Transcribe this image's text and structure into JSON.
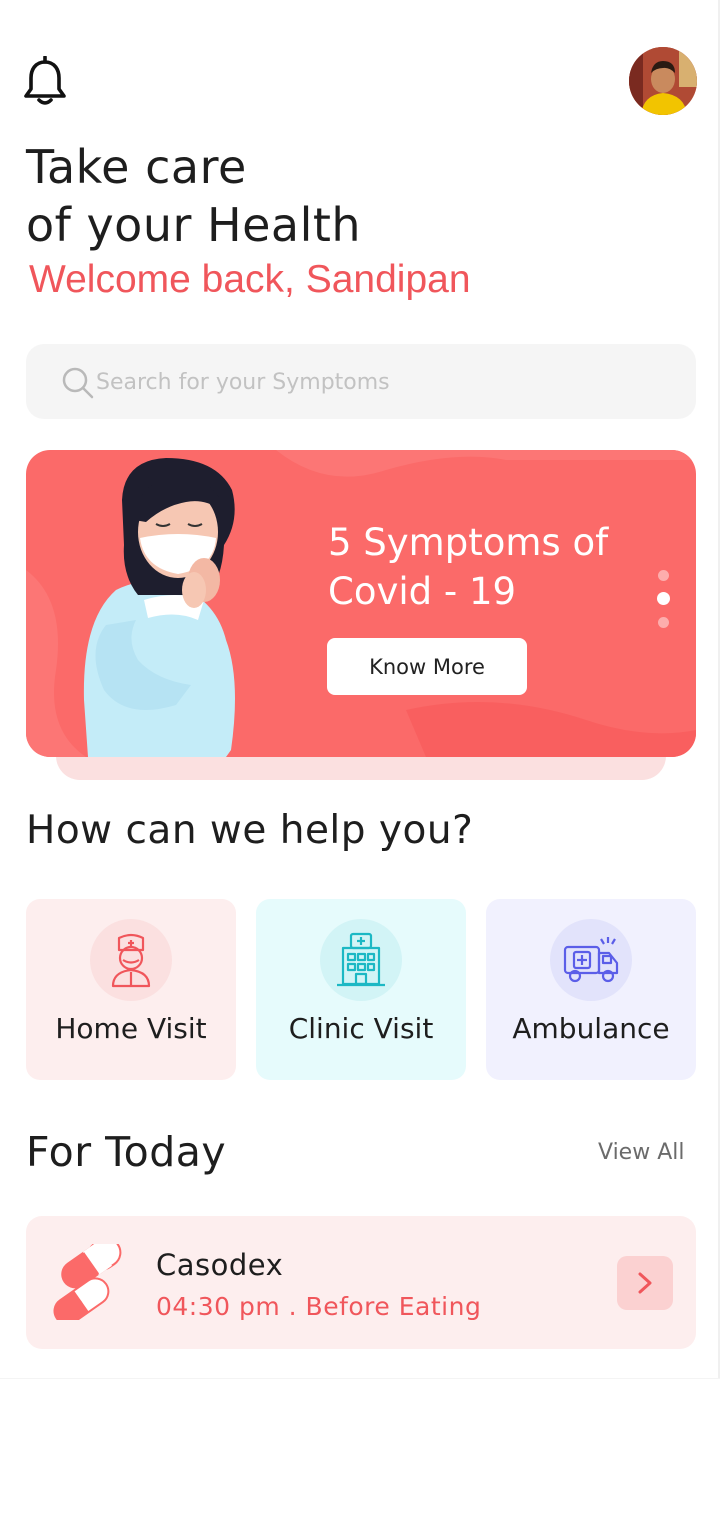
{
  "header": {
    "bell_icon": "bell-icon",
    "avatar_icon": "user-avatar"
  },
  "headline": {
    "line1": "Take care",
    "line2": "of your Health"
  },
  "welcome": "Welcome back, Sandipan",
  "search": {
    "placeholder": "Search for your Symptoms",
    "icon": "search-icon"
  },
  "banner": {
    "title_line1": "5 Symptoms of",
    "title_line2": "Covid - 19",
    "button_label": "Know More",
    "dots_count": 3,
    "active_dot": 2,
    "colors": {
      "background": "#fb6a69",
      "button": "#ffffff"
    }
  },
  "services": {
    "title": "How can we help you?",
    "items": [
      {
        "label": "Home Visit",
        "icon": "nurse-icon",
        "color": "#f0565b"
      },
      {
        "label": "Clinic Visit",
        "icon": "hospital-icon",
        "color": "#1cb8c4"
      },
      {
        "label": "Ambulance",
        "icon": "ambulance-icon",
        "color": "#5b5ee8"
      }
    ]
  },
  "today": {
    "title": "For Today",
    "view_all": "View All",
    "medicine": {
      "name": "Casodex",
      "time": "04:30 pm . Before Eating",
      "icon": "pill-icon"
    }
  },
  "colors": {
    "accent": "#f0565b",
    "text": "#1e1e1e"
  }
}
